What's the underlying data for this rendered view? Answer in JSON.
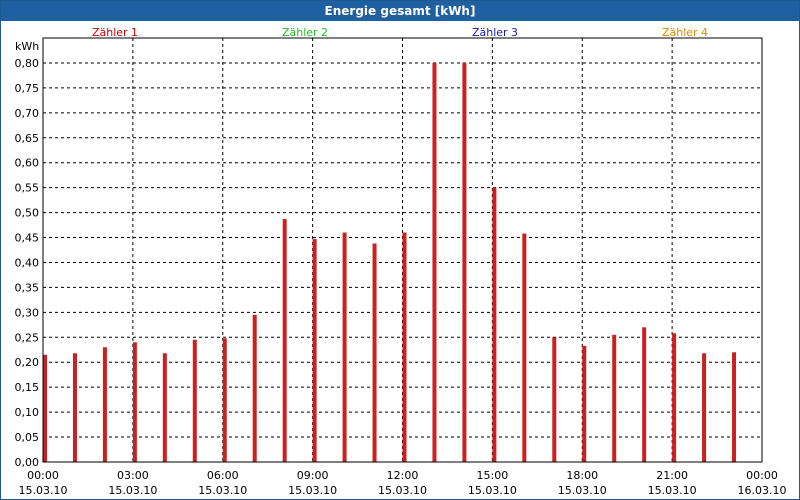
{
  "window": {
    "title": "Energie gesamt [kWh]"
  },
  "colors": {
    "bar": "#cc2020",
    "grid": "#000000",
    "titlebar": "#1f60a0"
  },
  "chart_data": {
    "type": "bar",
    "title": "Energie gesamt [kWh]",
    "ylabel": "kWh",
    "xlabel": "",
    "ylim": [
      0,
      0.85
    ],
    "yticks": [
      "0,00",
      "0,05",
      "0,10",
      "0,15",
      "0,20",
      "0,25",
      "0,30",
      "0,35",
      "0,40",
      "0,45",
      "0,50",
      "0,55",
      "0,60",
      "0,65",
      "0,70",
      "0,75",
      "0,80"
    ],
    "x_tick_labels": [
      {
        "time": "00:00",
        "date": "15.03.10"
      },
      {
        "time": "03:00",
        "date": "15.03.10"
      },
      {
        "time": "06:00",
        "date": "15.03.10"
      },
      {
        "time": "09:00",
        "date": "15.03.10"
      },
      {
        "time": "12:00",
        "date": "15.03.10"
      },
      {
        "time": "15:00",
        "date": "15.03.10"
      },
      {
        "time": "18:00",
        "date": "15.03.10"
      },
      {
        "time": "21:00",
        "date": "15.03.10"
      },
      {
        "time": "00:00",
        "date": "16.03.10"
      }
    ],
    "xrange_hours": [
      0,
      24
    ],
    "legend": [
      {
        "name": "Zähler 1",
        "color": "#cc0000"
      },
      {
        "name": "Zähler 2",
        "color": "#22bb22"
      },
      {
        "name": "Zähler 3",
        "color": "#1a1aaa"
      },
      {
        "name": "Zähler 4",
        "color": "#dd8800"
      }
    ],
    "legend_placement": "top",
    "grid": true,
    "series": [
      {
        "x_hours": [
          0,
          1,
          2,
          3,
          4,
          5,
          6,
          7,
          8,
          9,
          10,
          11,
          12,
          13,
          14,
          15,
          16,
          17,
          18,
          19,
          20,
          21,
          22,
          23
        ],
        "values": [
          0.215,
          0.218,
          0.23,
          0.24,
          0.218,
          0.245,
          0.248,
          0.295,
          0.487,
          0.447,
          0.46,
          0.438,
          0.46,
          0.8,
          0.8,
          0.55,
          0.458,
          0.25,
          0.233,
          0.255,
          0.27,
          0.258,
          0.218,
          0.22
        ]
      }
    ]
  }
}
